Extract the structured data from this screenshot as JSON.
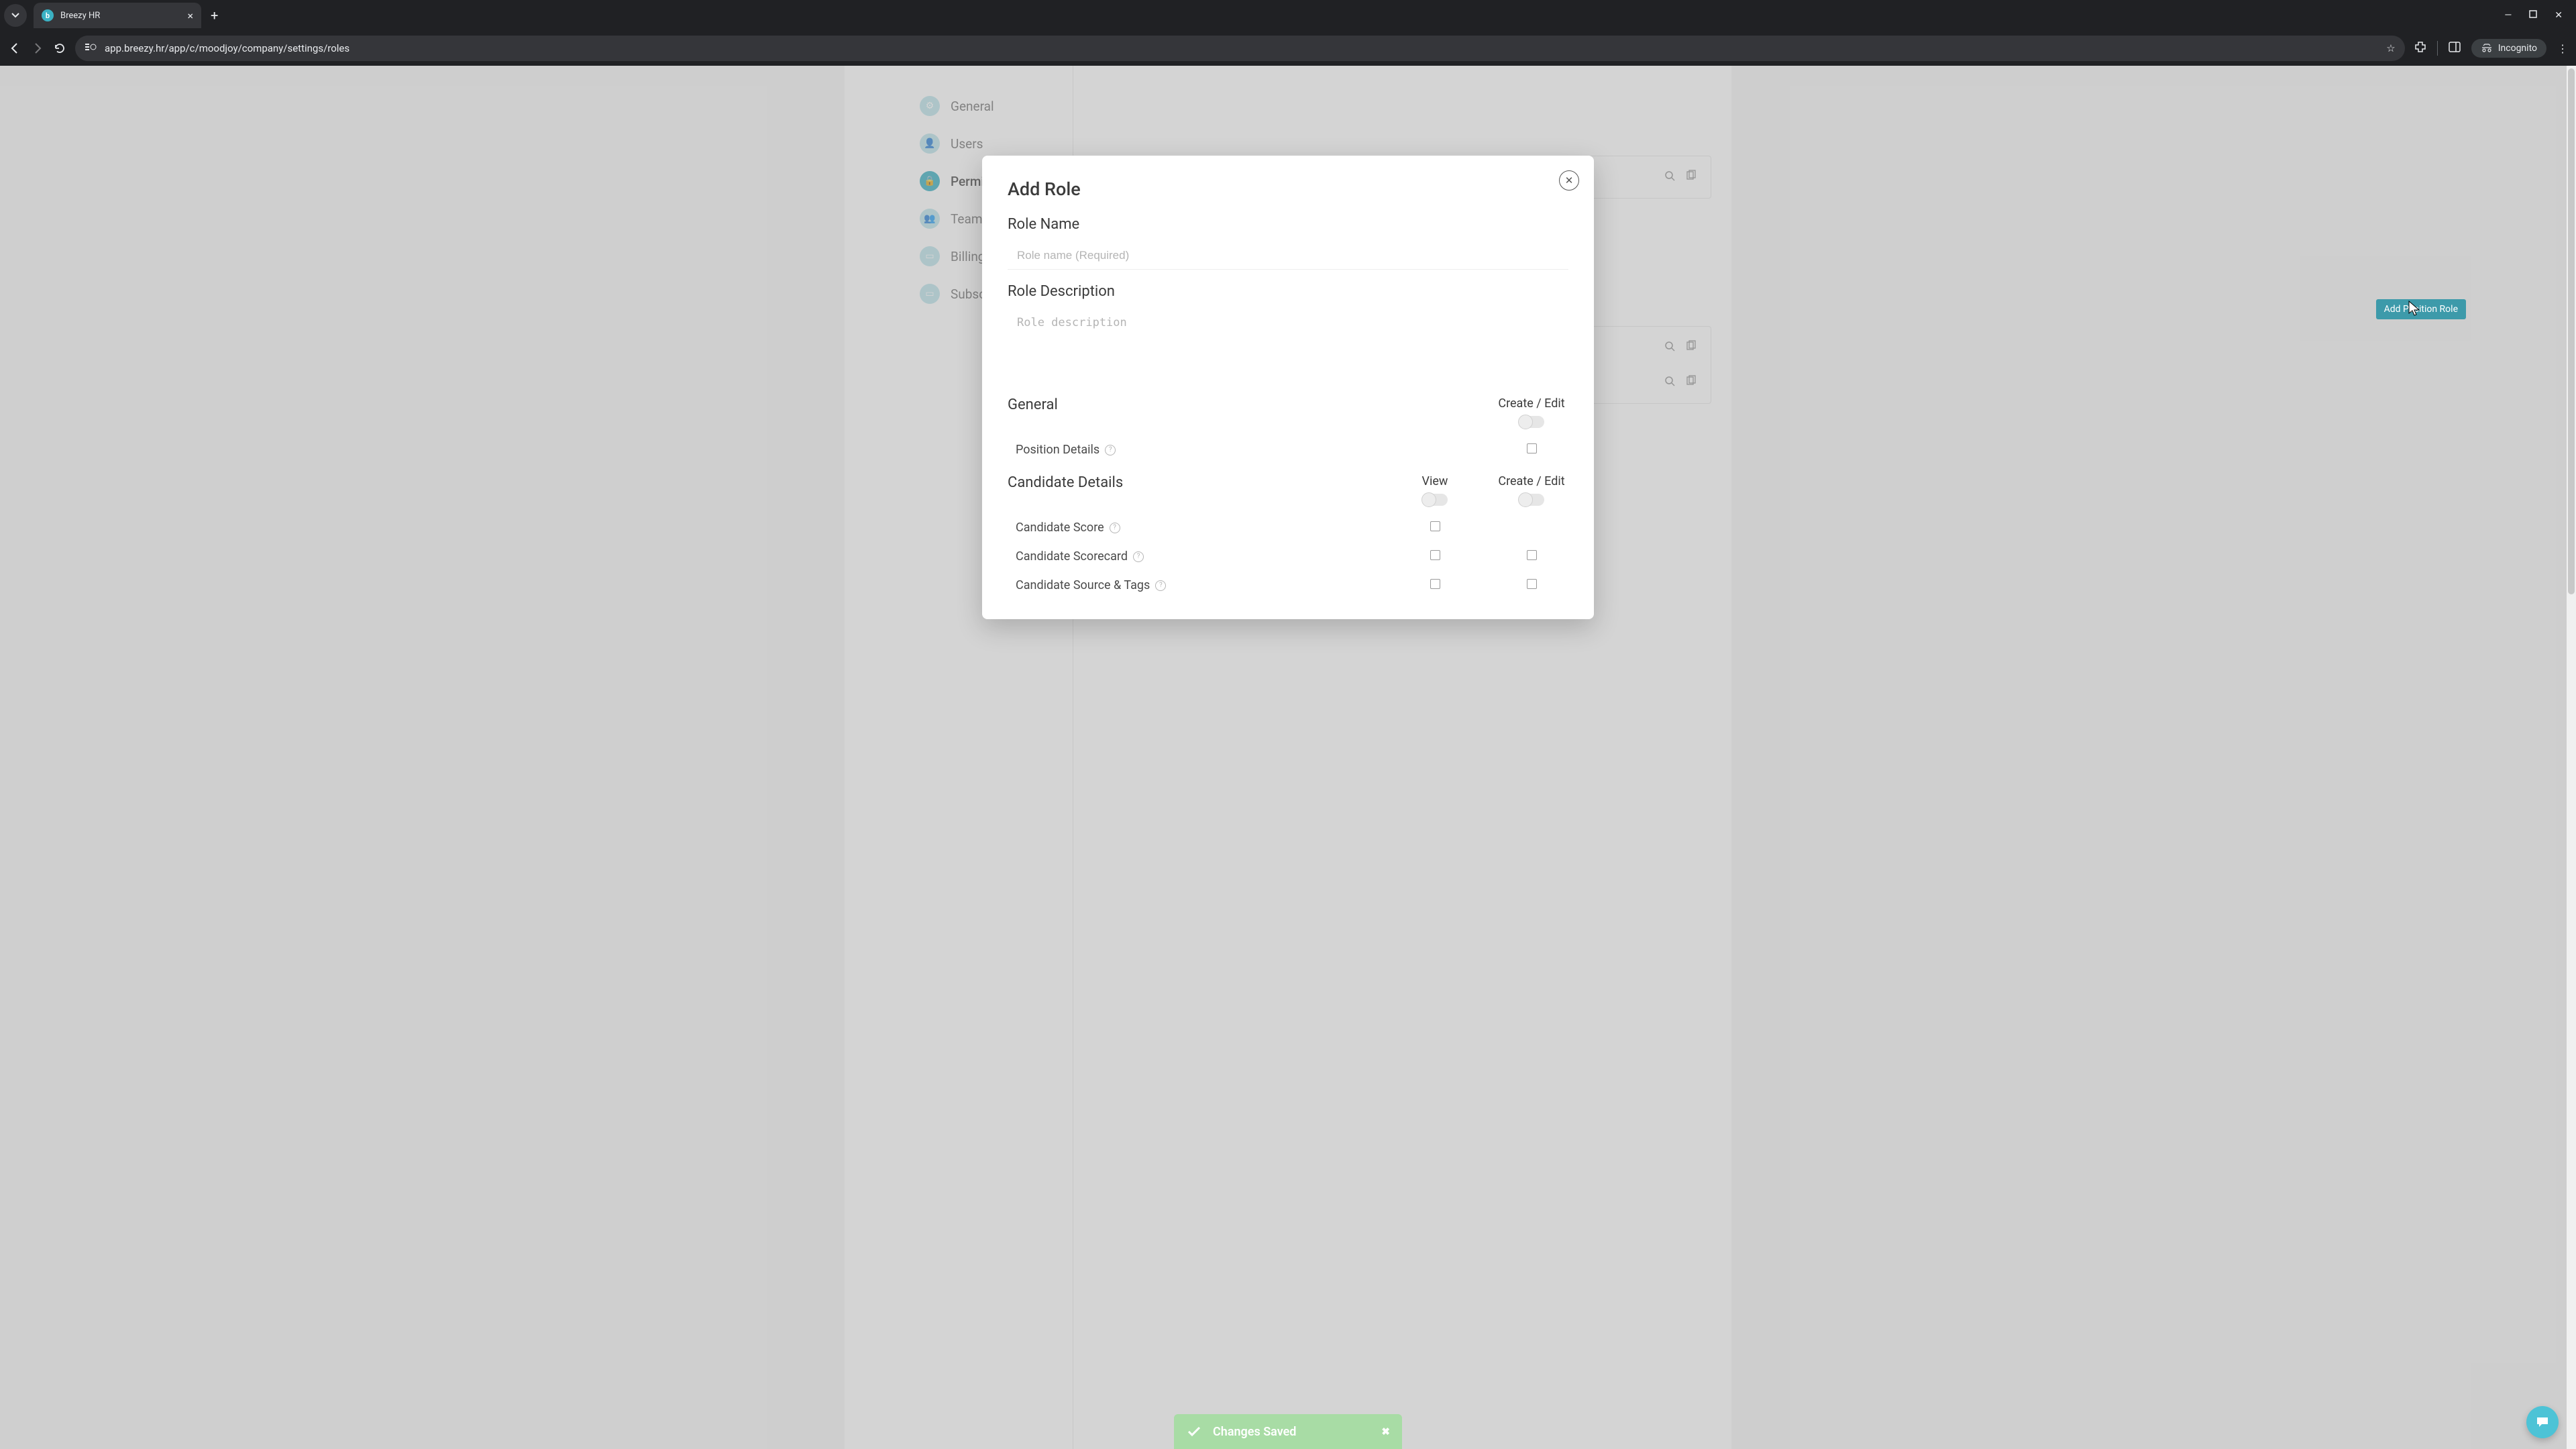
{
  "browser": {
    "tab_title": "Breezy HR",
    "url": "app.breezy.hr/app/c/moodjoy/company/settings/roles",
    "incognito_label": "Incognito"
  },
  "sidebar": {
    "items": [
      {
        "label": "General",
        "active": false
      },
      {
        "label": "Users",
        "active": false
      },
      {
        "label": "Permissions",
        "active": true
      },
      {
        "label": "Teams",
        "active": false
      },
      {
        "label": "Billing",
        "active": false
      },
      {
        "label": "Subscriptions",
        "active": false
      }
    ]
  },
  "background": {
    "add_position_role_label": "Add Position Role"
  },
  "modal": {
    "title": "Add Role",
    "role_name_label": "Role Name",
    "role_name_placeholder": "Role name (Required)",
    "role_desc_label": "Role Description",
    "role_desc_placeholder": "Role description",
    "sections": {
      "general": {
        "title": "General",
        "columns": {
          "create_edit": "Create / Edit"
        },
        "rows": [
          {
            "label": "Position Details"
          }
        ]
      },
      "candidate": {
        "title": "Candidate Details",
        "columns": {
          "view": "View",
          "create_edit": "Create / Edit"
        },
        "rows": [
          {
            "label": "Candidate Score"
          },
          {
            "label": "Candidate Scorecard"
          },
          {
            "label": "Candidate Source & Tags"
          }
        ]
      }
    }
  },
  "toast": {
    "message": "Changes Saved"
  }
}
